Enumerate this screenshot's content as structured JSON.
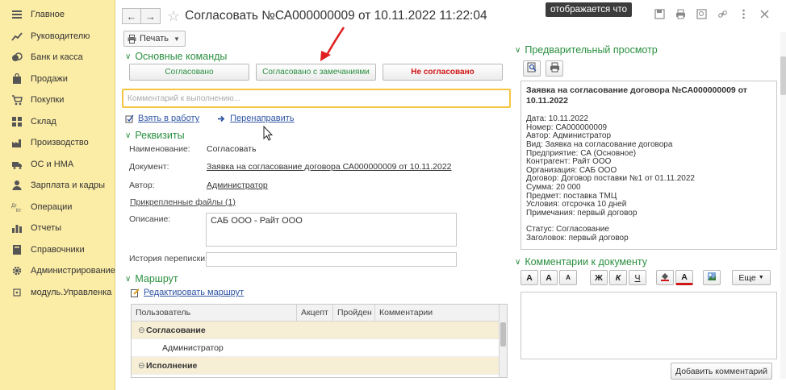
{
  "sidebar": {
    "items": [
      {
        "label": "Главное",
        "icon": "menu-icon"
      },
      {
        "label": "Руководителю",
        "icon": "chart-trend-icon"
      },
      {
        "label": "Банк и касса",
        "icon": "coins-icon"
      },
      {
        "label": "Продажи",
        "icon": "shopping-bag-icon"
      },
      {
        "label": "Покупки",
        "icon": "cart-icon"
      },
      {
        "label": "Склад",
        "icon": "warehouse-grid-icon"
      },
      {
        "label": "Производство",
        "icon": "factory-icon"
      },
      {
        "label": "ОС и НМА",
        "icon": "truck-icon"
      },
      {
        "label": "Зарплата и кадры",
        "icon": "person-icon"
      },
      {
        "label": "Операции",
        "icon": "dt-kt-icon"
      },
      {
        "label": "Отчеты",
        "icon": "bar-chart-icon"
      },
      {
        "label": "Справочники",
        "icon": "book-icon"
      },
      {
        "label": "Администрирование",
        "icon": "gear-icon"
      },
      {
        "label": "модуль.Управленка",
        "icon": "module-icon"
      }
    ]
  },
  "window": {
    "title": "Согласовать №СА000000009 от 10.11.2022 11:22:04",
    "tooltip": "отображается что",
    "print_label": "Печать"
  },
  "commands": {
    "section_title": "Основные команды",
    "approved": "Согласовано",
    "approved_remarks": "Согласовано с замечаниями",
    "not_approved": "Не согласовано",
    "comment_placeholder": "Комментарий к выполнению...",
    "take_to_work": "Взять в работу",
    "redirect": "Перенаправить"
  },
  "requisites": {
    "section_title": "Реквизиты",
    "name_label": "Наименование:",
    "name_value": "Согласовать",
    "document_label": "Документ:",
    "document_value": "Заявка на согласование договора СА000000009 от 10.11.2022",
    "author_label": "Автор:",
    "author_value": "Администратор",
    "attached_files": "Прикрепленные файлы (1)",
    "description_label": "Описание:",
    "description_value": "САБ ООО - Райт ООО",
    "history_label": "История переписки:"
  },
  "route": {
    "section_title": "Маршрут",
    "edit_route": "Редактировать маршрут",
    "columns": [
      "Пользователь",
      "Акцепт",
      "Пройден",
      "Комментарии"
    ],
    "rows": [
      {
        "type": "group",
        "label": "Согласование",
        "marker": "⊖"
      },
      {
        "type": "item",
        "label": "Администратор"
      },
      {
        "type": "group",
        "label": "Исполнение",
        "marker": "⊖"
      }
    ]
  },
  "preview": {
    "section_title": "Предварительный просмотр",
    "title": "Заявка на согласование договора №СА000000009 от 10.11.2022",
    "lines": [
      "Дата: 10.11.2022",
      "Номер: СА000000009",
      "Автор: Администратор",
      "Вид: Заявка на согласование договора",
      "Предприятие: СА (Основное)",
      "Контрагент: Райт ООО",
      "Организация: САБ ООО",
      "Договор: Договор поставки №1 от 01.11.2022",
      "Сумма: 20 000",
      "Предмет: поставка ТМЦ",
      "Условия: отсрочка 10 дней",
      "Примечания: первый договор"
    ],
    "status_lines": [
      "Статус: Согласование",
      "Заголовок: первый договор"
    ]
  },
  "doc_comments": {
    "section_title": "Комментарии к документу",
    "more_label": "Еще",
    "add_label": "Добавить комментарий",
    "fmt": {
      "font_a": "A",
      "font_grow": "A",
      "font_shrink": "A",
      "bold": "Ж",
      "italic": "К",
      "underline": "Ч",
      "color_a": "A"
    }
  },
  "colors": {
    "sidebar_bg": "#fbeca6",
    "section_green": "#2a8f3f",
    "link_blue": "#2f55a4",
    "danger_red": "#d01616",
    "focus_yellow": "#f5c542",
    "annotation_arrow": "#e02020"
  }
}
